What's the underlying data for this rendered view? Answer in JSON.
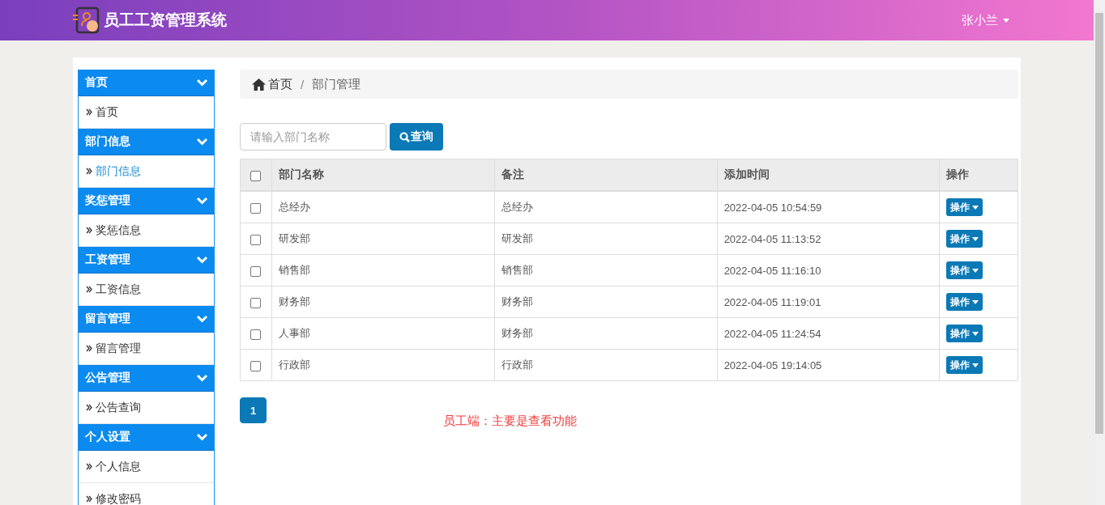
{
  "header": {
    "title": "员工工资管理系统",
    "user": "张小兰"
  },
  "sidebar": {
    "groups": [
      {
        "title": "首页",
        "items": [
          {
            "label": "首页",
            "selected": false
          }
        ]
      },
      {
        "title": "部门信息",
        "items": [
          {
            "label": "部门信息",
            "selected": true
          }
        ]
      },
      {
        "title": "奖惩管理",
        "items": [
          {
            "label": "奖惩信息",
            "selected": false
          }
        ]
      },
      {
        "title": "工资管理",
        "items": [
          {
            "label": "工资信息",
            "selected": false
          }
        ]
      },
      {
        "title": "留言管理",
        "items": [
          {
            "label": "留言管理",
            "selected": false
          }
        ]
      },
      {
        "title": "公告管理",
        "items": [
          {
            "label": "公告查询",
            "selected": false
          }
        ]
      },
      {
        "title": "个人设置",
        "items": [
          {
            "label": "个人信息",
            "selected": false
          },
          {
            "label": "修改密码",
            "selected": false
          }
        ]
      }
    ]
  },
  "breadcrumb": {
    "home": "首页",
    "separator": "/",
    "current": "部门管理"
  },
  "search": {
    "placeholder": "请输入部门名称",
    "button": "查询"
  },
  "table": {
    "columns": [
      "部门名称",
      "备注",
      "添加时间",
      "操作"
    ],
    "all_checked": false,
    "rows": [
      {
        "name": "总经办",
        "note": "总经办",
        "time": "2022-04-05 10:54:59",
        "action": "操作",
        "checked": false
      },
      {
        "name": "研发部",
        "note": "研发部",
        "time": "2022-04-05 11:13:52",
        "action": "操作",
        "checked": false
      },
      {
        "name": "销售部",
        "note": "销售部",
        "time": "2022-04-05 11:16:10",
        "action": "操作",
        "checked": false
      },
      {
        "name": "财务部",
        "note": "财务部",
        "time": "2022-04-05 11:19:01",
        "action": "操作",
        "checked": false
      },
      {
        "name": "人事部",
        "note": "财务部",
        "time": "2022-04-05 11:24:54",
        "action": "操作",
        "checked": false
      },
      {
        "name": "行政部",
        "note": "行政部",
        "time": "2022-04-05 19:14:05",
        "action": "操作",
        "checked": false
      }
    ]
  },
  "pagination": [
    {
      "label": "1",
      "selected": true
    }
  ],
  "note": "员工端：主要是查看功能"
}
